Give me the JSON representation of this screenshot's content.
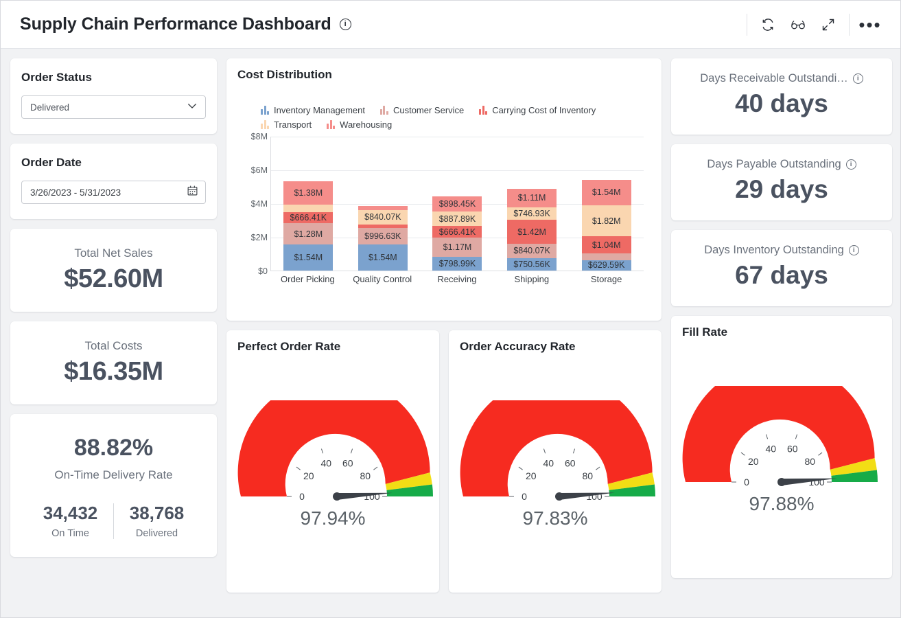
{
  "header": {
    "title": "Supply Chain Performance Dashboard",
    "info_glyph": "i",
    "actions": [
      {
        "name": "refresh-icon",
        "label": "Refresh"
      },
      {
        "name": "glasses-icon",
        "label": "Reader view"
      },
      {
        "name": "expand-icon",
        "label": "Full screen"
      },
      {
        "name": "more-options-icon",
        "label": "More options"
      }
    ]
  },
  "filters": {
    "order_status": {
      "label": "Order Status",
      "value": "Delivered",
      "options": [
        "Delivered"
      ]
    },
    "order_date": {
      "label": "Order Date",
      "value": "3/26/2023 - 5/31/2023"
    }
  },
  "kpis_left": [
    {
      "title": "Total Net Sales",
      "value": "$52.60M"
    },
    {
      "title": "Total Costs",
      "value": "$16.35M"
    }
  ],
  "on_time": {
    "percent": "88.82%",
    "label": "On-Time Delivery Rate",
    "on_time_count": "34,432",
    "on_time_label": "On Time",
    "delivered_count": "38,768",
    "delivered_label": "Delivered"
  },
  "kpis_right": [
    {
      "title": "Days Receivable Outstandi…",
      "value": "40 days"
    },
    {
      "title": "Days Payable Outstanding",
      "value": "29 days"
    },
    {
      "title": "Days Inventory Outstanding",
      "value": "67 days"
    }
  ],
  "gauges": [
    {
      "title": "Perfect Order Rate",
      "value": "97.94%",
      "numeric": 97.94
    },
    {
      "title": "Order Accuracy Rate",
      "value": "97.83%",
      "numeric": 97.83
    },
    {
      "title": "Fill Rate",
      "value": "97.88%",
      "numeric": 97.88
    }
  ],
  "gauge_scale": {
    "ticks": [
      "0",
      "20",
      "40",
      "60",
      "80",
      "100"
    ],
    "bands": [
      {
        "from": 0,
        "to": 92,
        "color": "#f62b20"
      },
      {
        "from": 92,
        "to": 96,
        "color": "#f2dd15"
      },
      {
        "from": 96,
        "to": 100,
        "color": "#16ab48"
      }
    ],
    "needle_color": "#3c4148"
  },
  "chart_data": {
    "type": "bar",
    "stacked": true,
    "title": "Cost Distribution",
    "xlabel": "",
    "ylabel": "",
    "ylim": [
      0,
      8000000
    ],
    "yticks": [
      "$0",
      "$2M",
      "$4M",
      "$6M",
      "$8M"
    ],
    "ytick_values": [
      0,
      2000000,
      4000000,
      6000000,
      8000000
    ],
    "grid": true,
    "legend_position": "top",
    "categories": [
      "Order Picking",
      "Quality Control",
      "Receiving",
      "Shipping",
      "Storage"
    ],
    "series": [
      {
        "name": "Inventory Management",
        "color": "#7ba2ce",
        "values": [
          1540000,
          1540000,
          798990,
          750560,
          629590
        ],
        "labels": [
          "$1.54M",
          "$1.54M",
          "$798.99K",
          "$750.56K",
          "$629.59K"
        ]
      },
      {
        "name": "Customer Service",
        "color": "#dfa9a3",
        "values": [
          1280000,
          996630,
          1170000,
          840070,
          380000
        ],
        "labels": [
          "$1.28M",
          "$996.63K",
          "$1.17M",
          "$840.07K",
          ""
        ]
      },
      {
        "name": "Carrying Cost of Inventory",
        "color": "#ee6a64",
        "values": [
          666410,
          220000,
          666410,
          1420000,
          1040000
        ],
        "labels": [
          "$666.41K",
          "",
          "$666.41K",
          "$1.42M",
          "$1.04M"
        ]
      },
      {
        "name": "Transport",
        "color": "#fad6b0",
        "values": [
          430000,
          840070,
          887890,
          746930,
          1820000
        ],
        "labels": [
          "",
          "$840.07K",
          "$887.89K",
          "$746.93K",
          "$1.82M"
        ]
      },
      {
        "name": "Warehousing",
        "color": "#f58d8a",
        "values": [
          1380000,
          230000,
          898450,
          1110000,
          1540000
        ],
        "labels": [
          "$1.38M",
          "",
          "$898.45K",
          "$1.11M",
          "$1.54M"
        ]
      }
    ]
  }
}
